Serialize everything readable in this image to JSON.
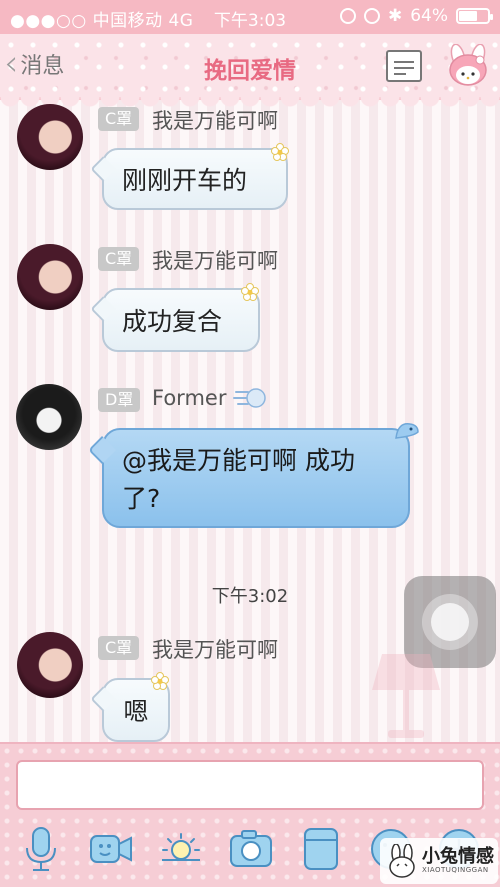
{
  "status_bar": {
    "signal": "●●●○○",
    "carrier": "中国移动",
    "network": "4G",
    "time": "下午3:03",
    "battery_percent": "64%",
    "battery_level": 0.64
  },
  "nav": {
    "back_label": "消息",
    "title": "挽回爱情",
    "menu_icon": "list-icon",
    "profile_icon": "my-melody-icon"
  },
  "messages": [
    {
      "tag": "C罩",
      "sender": "我是万能可啊",
      "text": "刚刚开车的"
    },
    {
      "tag": "C罩",
      "sender": "我是万能可啊",
      "text": "成功复合"
    },
    {
      "tag": "D罩",
      "sender": "Former",
      "line1": "@我是万能可啊 成功",
      "line2": "了?"
    },
    {
      "tag": "C罩",
      "sender": "我是万能可啊",
      "text": "嗯"
    }
  ],
  "timestamp": "下午3:02",
  "input": {
    "placeholder": ""
  },
  "toolbar": [
    "mic-icon",
    "video-icon",
    "image-icon",
    "camera-icon",
    "file-icon",
    "emoji-icon",
    "plus-icon"
  ],
  "watermark": {
    "main": "小兔情感",
    "sub": "XIAOTUQINGGAN"
  },
  "colors": {
    "accent": "#e86a82",
    "nav_bg": "#fbe3e8",
    "bubble_blue": "#8bc1ec",
    "bottom_bg": "#f6cdd5"
  }
}
